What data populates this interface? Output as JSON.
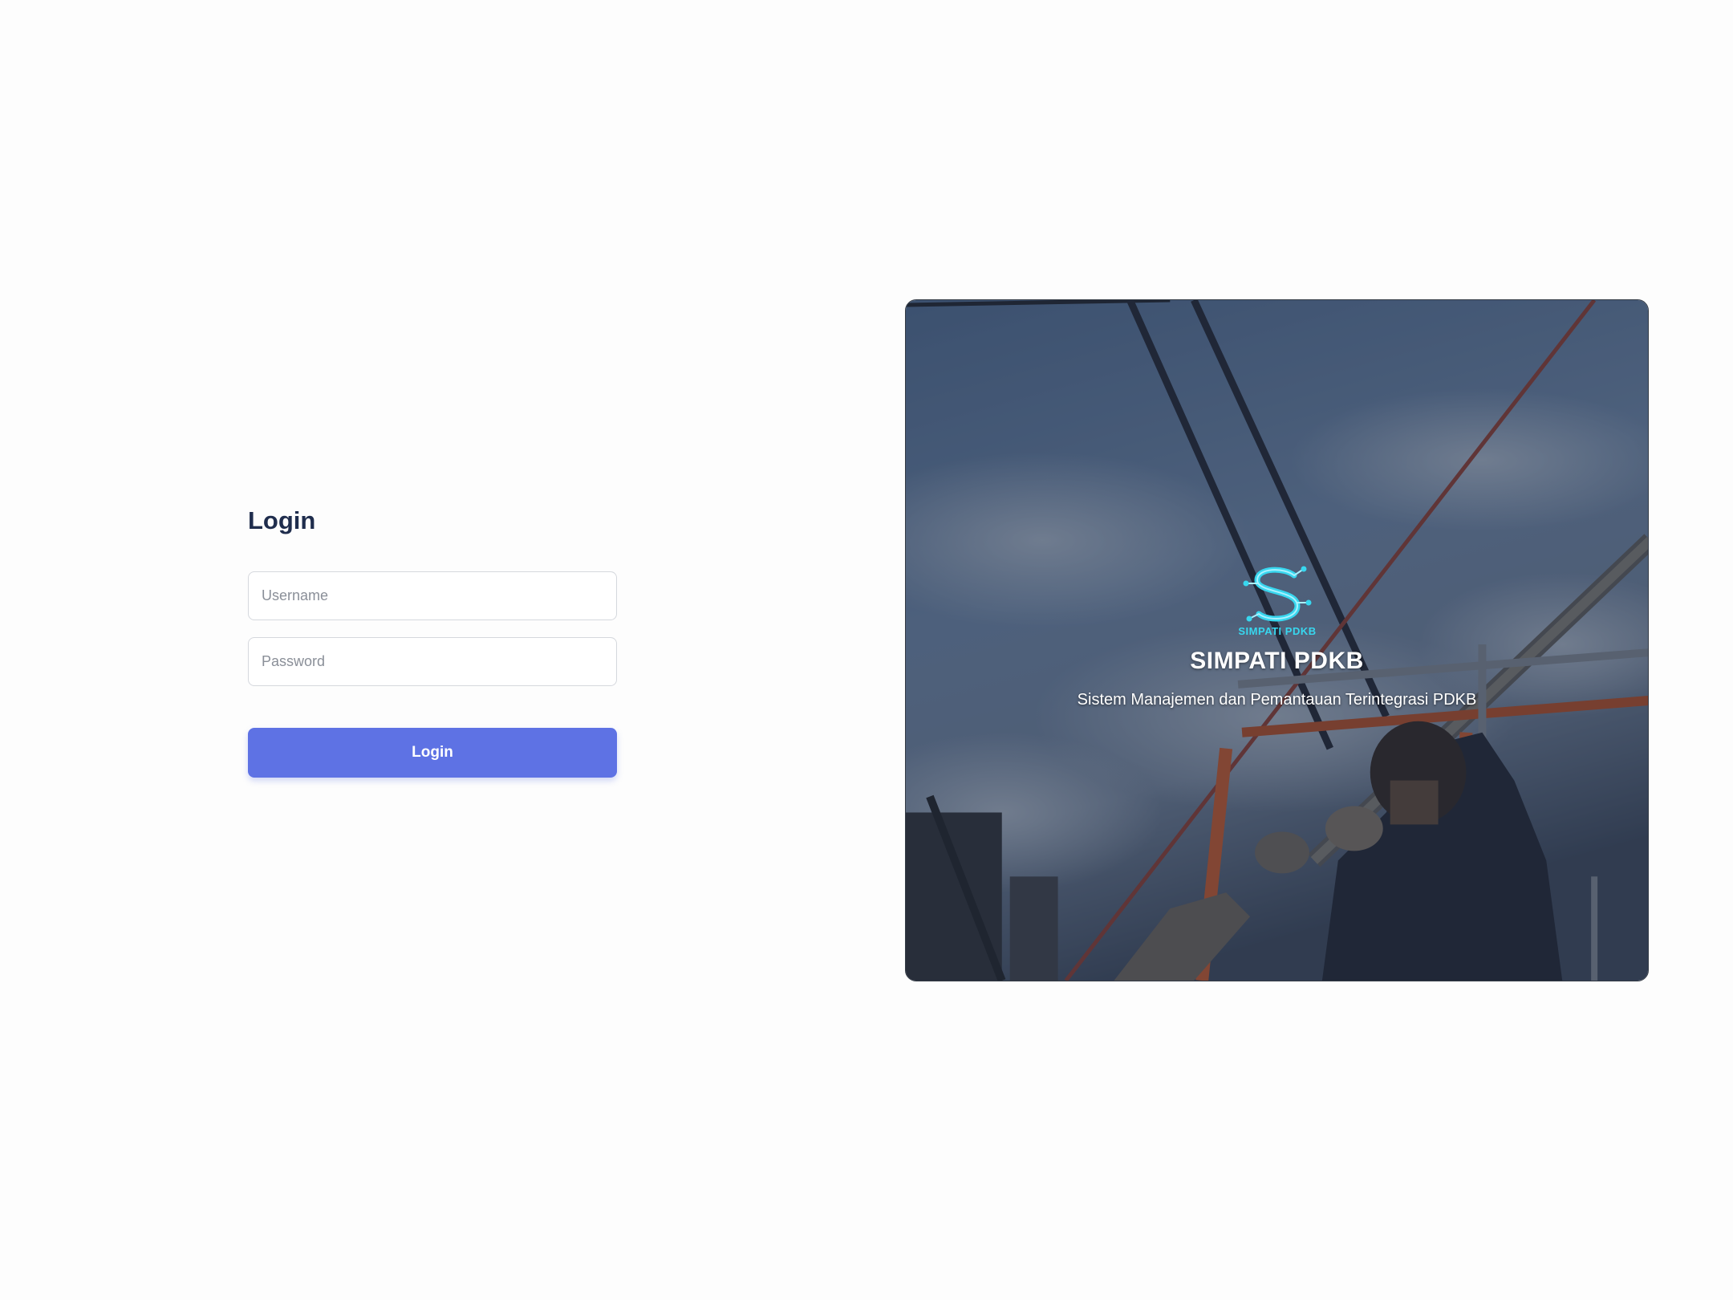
{
  "login": {
    "title": "Login",
    "username_placeholder": "Username",
    "password_placeholder": "Password",
    "submit_label": "Login"
  },
  "hero": {
    "logo_icon": "simpati-s-logo-icon",
    "logo_text": "SIMPATI PDKB",
    "brand_name": "SIMPATI PDKB",
    "tagline": "Sistem Manajemen dan Pemantauan Terintegrasi PDKB"
  },
  "colors": {
    "accent": "#5e72e4",
    "title": "#1f2d4d",
    "logo_cyan": "#38d7ef"
  }
}
